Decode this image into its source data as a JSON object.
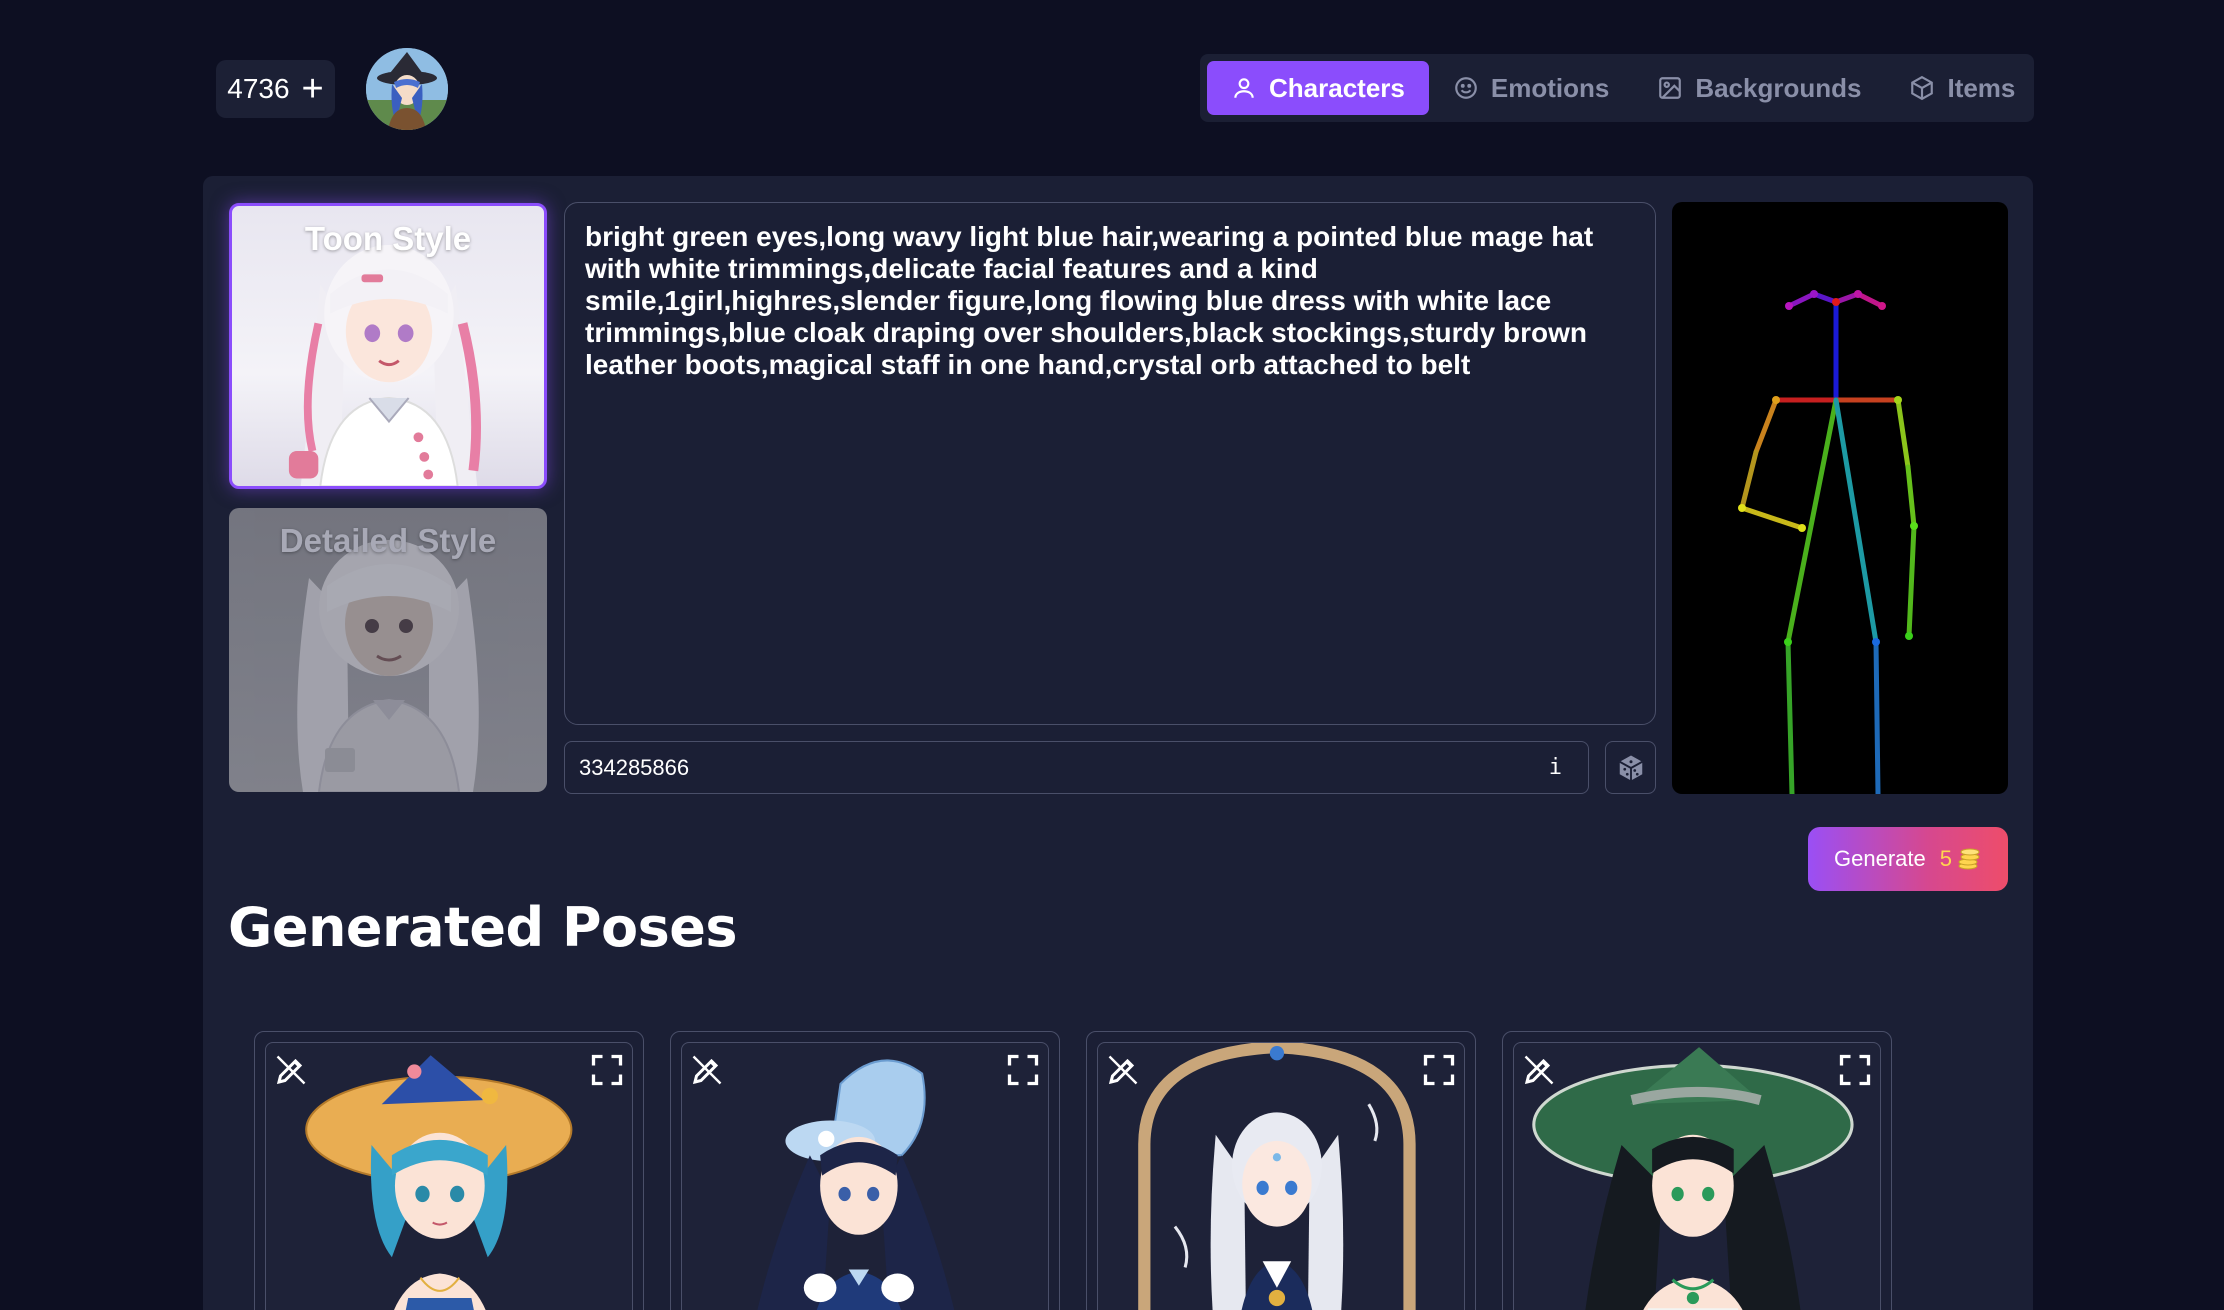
{
  "header": {
    "credits": "4736",
    "credits_add": "+"
  },
  "nav": {
    "tabs": [
      {
        "label": "Characters",
        "icon": "user-icon",
        "active": true
      },
      {
        "label": "Emotions",
        "icon": "smile-icon",
        "active": false
      },
      {
        "label": "Backgrounds",
        "icon": "image-icon",
        "active": false
      },
      {
        "label": "Items",
        "icon": "box-icon",
        "active": false
      }
    ]
  },
  "styles": [
    {
      "label": "Toon Style",
      "selected": true
    },
    {
      "label": "Detailed Style",
      "selected": false
    }
  ],
  "prompt": {
    "value": "bright green eyes,long wavy light blue hair,wearing a pointed blue mage hat with white trimmings,delicate facial features and a kind smile,1girl,highres,slender figure,long flowing blue dress with white lace trimmings,blue cloak draping over shoulders,black stockings,sturdy brown leather boots,magical staff in one hand,crystal orb attached to belt"
  },
  "seed": {
    "value": "334285866",
    "info_label": "i"
  },
  "generate": {
    "label": "Generate",
    "cost": "5"
  },
  "results": {
    "heading": "Generated Poses",
    "count": 4
  },
  "colors": {
    "accent": "#8b4dfc",
    "background": "#0d0f22",
    "panel": "#1b1f35"
  }
}
